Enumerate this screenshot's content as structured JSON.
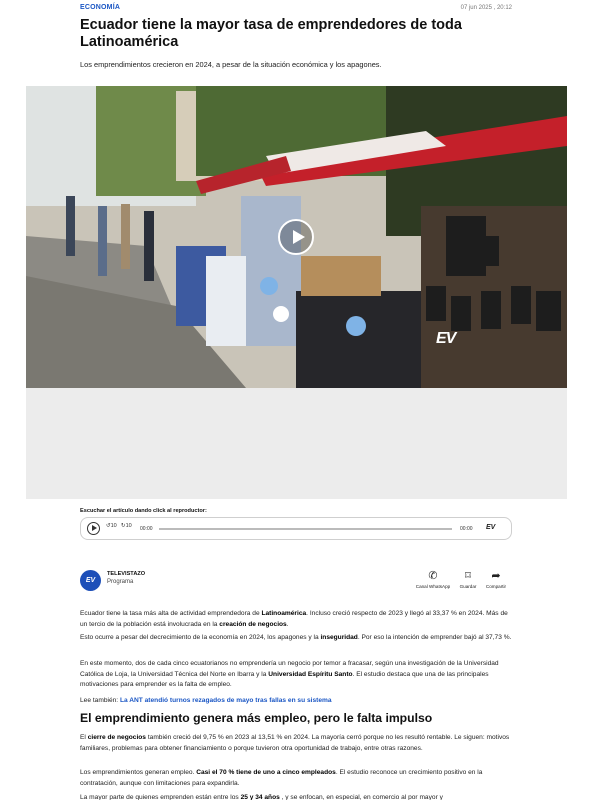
{
  "article": {
    "section": "ECONOMÍA",
    "dateline": "07 jun 2025 , 20:12",
    "title": "Ecuador tiene la mayor tasa de emprendedores de toda Latinoamérica",
    "subtitle": "Los emprendimientos crecieron en 2024, a pesar de la situación económica y los apagones."
  },
  "video": {
    "watermark": "EV"
  },
  "audio": {
    "label": "Escuchar el artículo dando click al reproductor:",
    "back_label": "10",
    "forward_label": "10",
    "time_start": "00:00",
    "time_end": "00:00",
    "logo_text": "EV"
  },
  "source": {
    "logo_text": "EV",
    "name": "TELEVISTAZO",
    "type": "Programa"
  },
  "share": [
    {
      "icon": "whatsapp-icon",
      "label": "Canal WhatsApp"
    },
    {
      "icon": "bookmark-icon",
      "label": "Guardar"
    },
    {
      "icon": "share-icon",
      "label": "Compartir"
    }
  ],
  "body": {
    "p1": [
      {
        "t": "Ecuador tiene la tasa más alta de actividad emprendedora de "
      },
      {
        "t": "Latinoamérica",
        "b": true
      },
      {
        "t": ". Incluso creció respecto de 2023 y llegó al 33,37 % en 2024. Más de un tercio de la población está involucrada en la "
      },
      {
        "t": "creación de negocios",
        "b": true
      },
      {
        "t": "."
      }
    ],
    "p2": [
      {
        "t": "Esto ocurre a pesar del decrecimiento de la economía en 2024, los apagones y la "
      },
      {
        "t": "inseguridad",
        "b": true
      },
      {
        "t": ". Por eso la intención de emprender bajó al 37,73 %."
      }
    ],
    "p3": [
      {
        "t": "En este momento, dos de cada cinco ecuatorianos no emprendería un negocio por temor a fracasar, según una investigación de la Universidad Católica de Loja, la Universidad Técnica del Norte en Ibarra y la "
      },
      {
        "t": "Universidad Espíritu Santo",
        "b": true
      },
      {
        "t": ". El estudio destaca que una de las principales motivaciones para emprender es la falta de empleo."
      }
    ],
    "related_prefix": "Lee también:",
    "related_link": "La ANT atendió turnos rezagados de mayo tras fallas en su sistema",
    "h2": "El emprendimiento genera más empleo, pero le falta impulso",
    "p4": [
      {
        "t": "El "
      },
      {
        "t": "cierre de negocios",
        "b": true
      },
      {
        "t": " también creció del 9,75 % en 2023 al 13,51 % en 2024. La mayoría cerró porque no les resultó rentable. Le siguen: motivos familiares, problemas para obtener financiamiento o porque tuvieron otra oportunidad de trabajo, entre otras razones."
      }
    ],
    "p5": [
      {
        "t": "Los emprendimientos generan empleo. "
      },
      {
        "t": "Casi el 70 % tiene de uno a cinco empleados",
        "b": true
      },
      {
        "t": ". El estudio reconoce un crecimiento positivo en la contratación, aunque con limitaciones para expandirla."
      }
    ],
    "p6": [
      {
        "t": "La mayor parte de quienes emprenden están entre los "
      },
      {
        "t": "25 y 34 años",
        "b": true
      },
      {
        "t": " , y se enfocan, en especial, en comercio al por mayor y"
      }
    ]
  },
  "colors": {
    "accent": "#1a56c4",
    "brand": "#1d4fb8"
  }
}
